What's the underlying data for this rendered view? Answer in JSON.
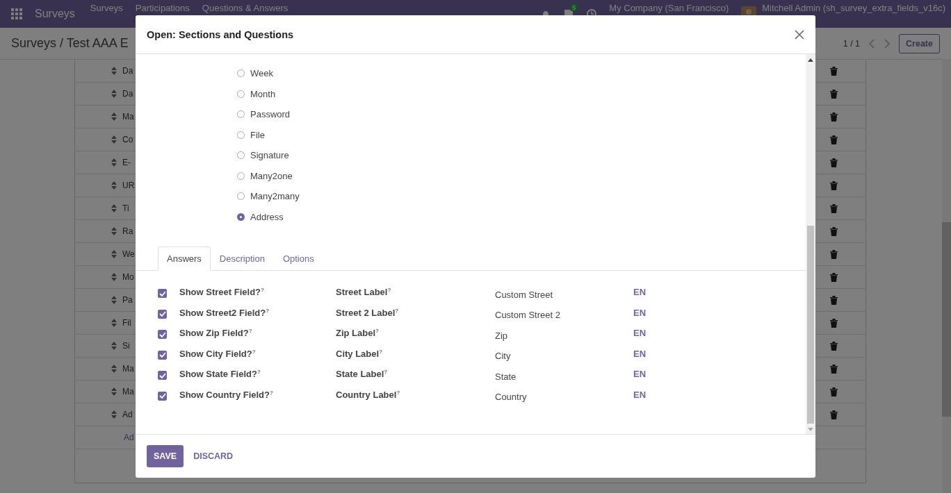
{
  "navbar": {
    "brand": "Surveys",
    "menu": [
      "Surveys",
      "Participations",
      "Questions & Answers"
    ],
    "message_count": "5",
    "company": "My Company (San Francisco)",
    "user": "Mitchell Admin (sh_survey_extra_fields_v16c)"
  },
  "control_panel": {
    "breadcrumb": "Surveys / Test AAA E",
    "pager": "1 / 1",
    "create": "Create"
  },
  "list_rows": [
    {
      "kind": "line",
      "text": "Da"
    },
    {
      "kind": "line",
      "text": "Da"
    },
    {
      "kind": "line",
      "text": "Ma"
    },
    {
      "kind": "line",
      "text": "Co"
    },
    {
      "kind": "line",
      "text": "E-"
    },
    {
      "kind": "line",
      "text": "UR"
    },
    {
      "kind": "line",
      "text": "Ti"
    },
    {
      "kind": "line",
      "text": "Ra"
    },
    {
      "kind": "line",
      "text": "We"
    },
    {
      "kind": "line",
      "text": "Mo"
    },
    {
      "kind": "line",
      "text": "Pa"
    },
    {
      "kind": "line",
      "text": "Fil"
    },
    {
      "kind": "line",
      "text": "Si"
    },
    {
      "kind": "line",
      "text": "Ma"
    },
    {
      "kind": "line",
      "text": "Ma"
    },
    {
      "kind": "line",
      "text": "Ad"
    },
    {
      "kind": "add",
      "text": "Ad"
    }
  ],
  "dialog": {
    "title": "Open: Sections and Questions",
    "question_types": [
      {
        "label": "Week",
        "selected": false
      },
      {
        "label": "Month",
        "selected": false
      },
      {
        "label": "Password",
        "selected": false
      },
      {
        "label": "File",
        "selected": false
      },
      {
        "label": "Signature",
        "selected": false
      },
      {
        "label": "Many2one",
        "selected": false
      },
      {
        "label": "Many2many",
        "selected": false
      },
      {
        "label": "Address",
        "selected": true
      }
    ],
    "tabs": [
      {
        "label": "Answers",
        "selected": true
      },
      {
        "label": "Description",
        "selected": false
      },
      {
        "label": "Options",
        "selected": false
      }
    ],
    "answers": [
      {
        "show_label": "Show Street Field?$^{?}$",
        "checked": true,
        "label_label": "Street Label$^{?}$",
        "value": "Custom Street",
        "lang": "EN"
      },
      {
        "show_label": "Show Street2 Field?$^{?}$",
        "checked": true,
        "label_label": "Street 2 Label$^{?}$",
        "value": "Custom Street 2",
        "lang": "EN"
      },
      {
        "show_label": "Show Zip Field?$^{?}$",
        "checked": true,
        "label_label": "Zip Label$^{?}$",
        "value": "Zip",
        "lang": "EN"
      },
      {
        "show_label": "Show City Field?$^{?}$",
        "checked": true,
        "label_label": "City Label$^{?}$",
        "value": "City",
        "lang": "EN"
      },
      {
        "show_label": "Show State Field?$^{?}$",
        "checked": true,
        "label_label": "State Label$^{?}$",
        "value": "State",
        "lang": "EN"
      },
      {
        "show_label": "Show Country Field?$^{?}$",
        "checked": true,
        "label_label": "Country Label$^{?}$",
        "value": "Country",
        "lang": "EN"
      }
    ],
    "save": "SAVE",
    "discard": "DISCARD"
  }
}
